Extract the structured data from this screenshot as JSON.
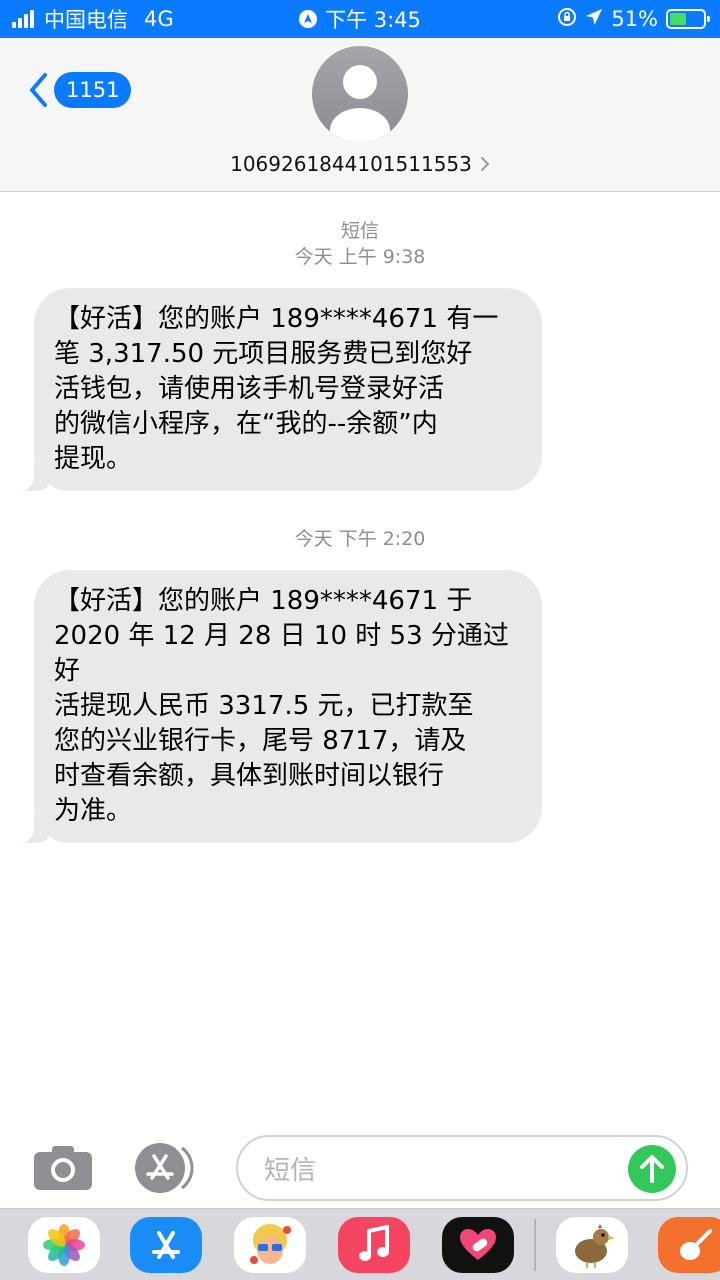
{
  "status_bar": {
    "carrier": "中国电信",
    "network": "4G",
    "time": "下午 3:45",
    "battery_percent": "51%",
    "battery_level": 0.51,
    "background_color": "#0a7bff"
  },
  "header": {
    "back_count": "1151",
    "contact_number": "1069261844101511553"
  },
  "messages": [
    {
      "service": "短信",
      "timestamp": "今天 上午 9:38",
      "text": "【好活】您的账户 189****4671 有一\n笔 3,317.50 元项目服务费已到您好\n活钱包，请使用该手机号登录好活\n的微信小程序，在“我的--余额”内\n提现。"
    },
    {
      "timestamp": "今天 下午 2:20",
      "text": "【好活】您的账户 189****4671 于\n2020 年 12 月 28 日 10 时 53 分通过好\n活提现人民币 3317.5 元，已打款至\n您的兴业银行卡，尾号 8717，请及\n时查看余额，具体到账时间以银行\n为准。"
    }
  ],
  "input_bar": {
    "placeholder": "短信",
    "send_color": "#34c759"
  },
  "app_drawer": {
    "apps": [
      "photos-icon",
      "app-store-icon",
      "memoji-icon",
      "music-icon",
      "digital-touch-icon",
      "bird-sticker-icon",
      "garageband-icon"
    ]
  }
}
